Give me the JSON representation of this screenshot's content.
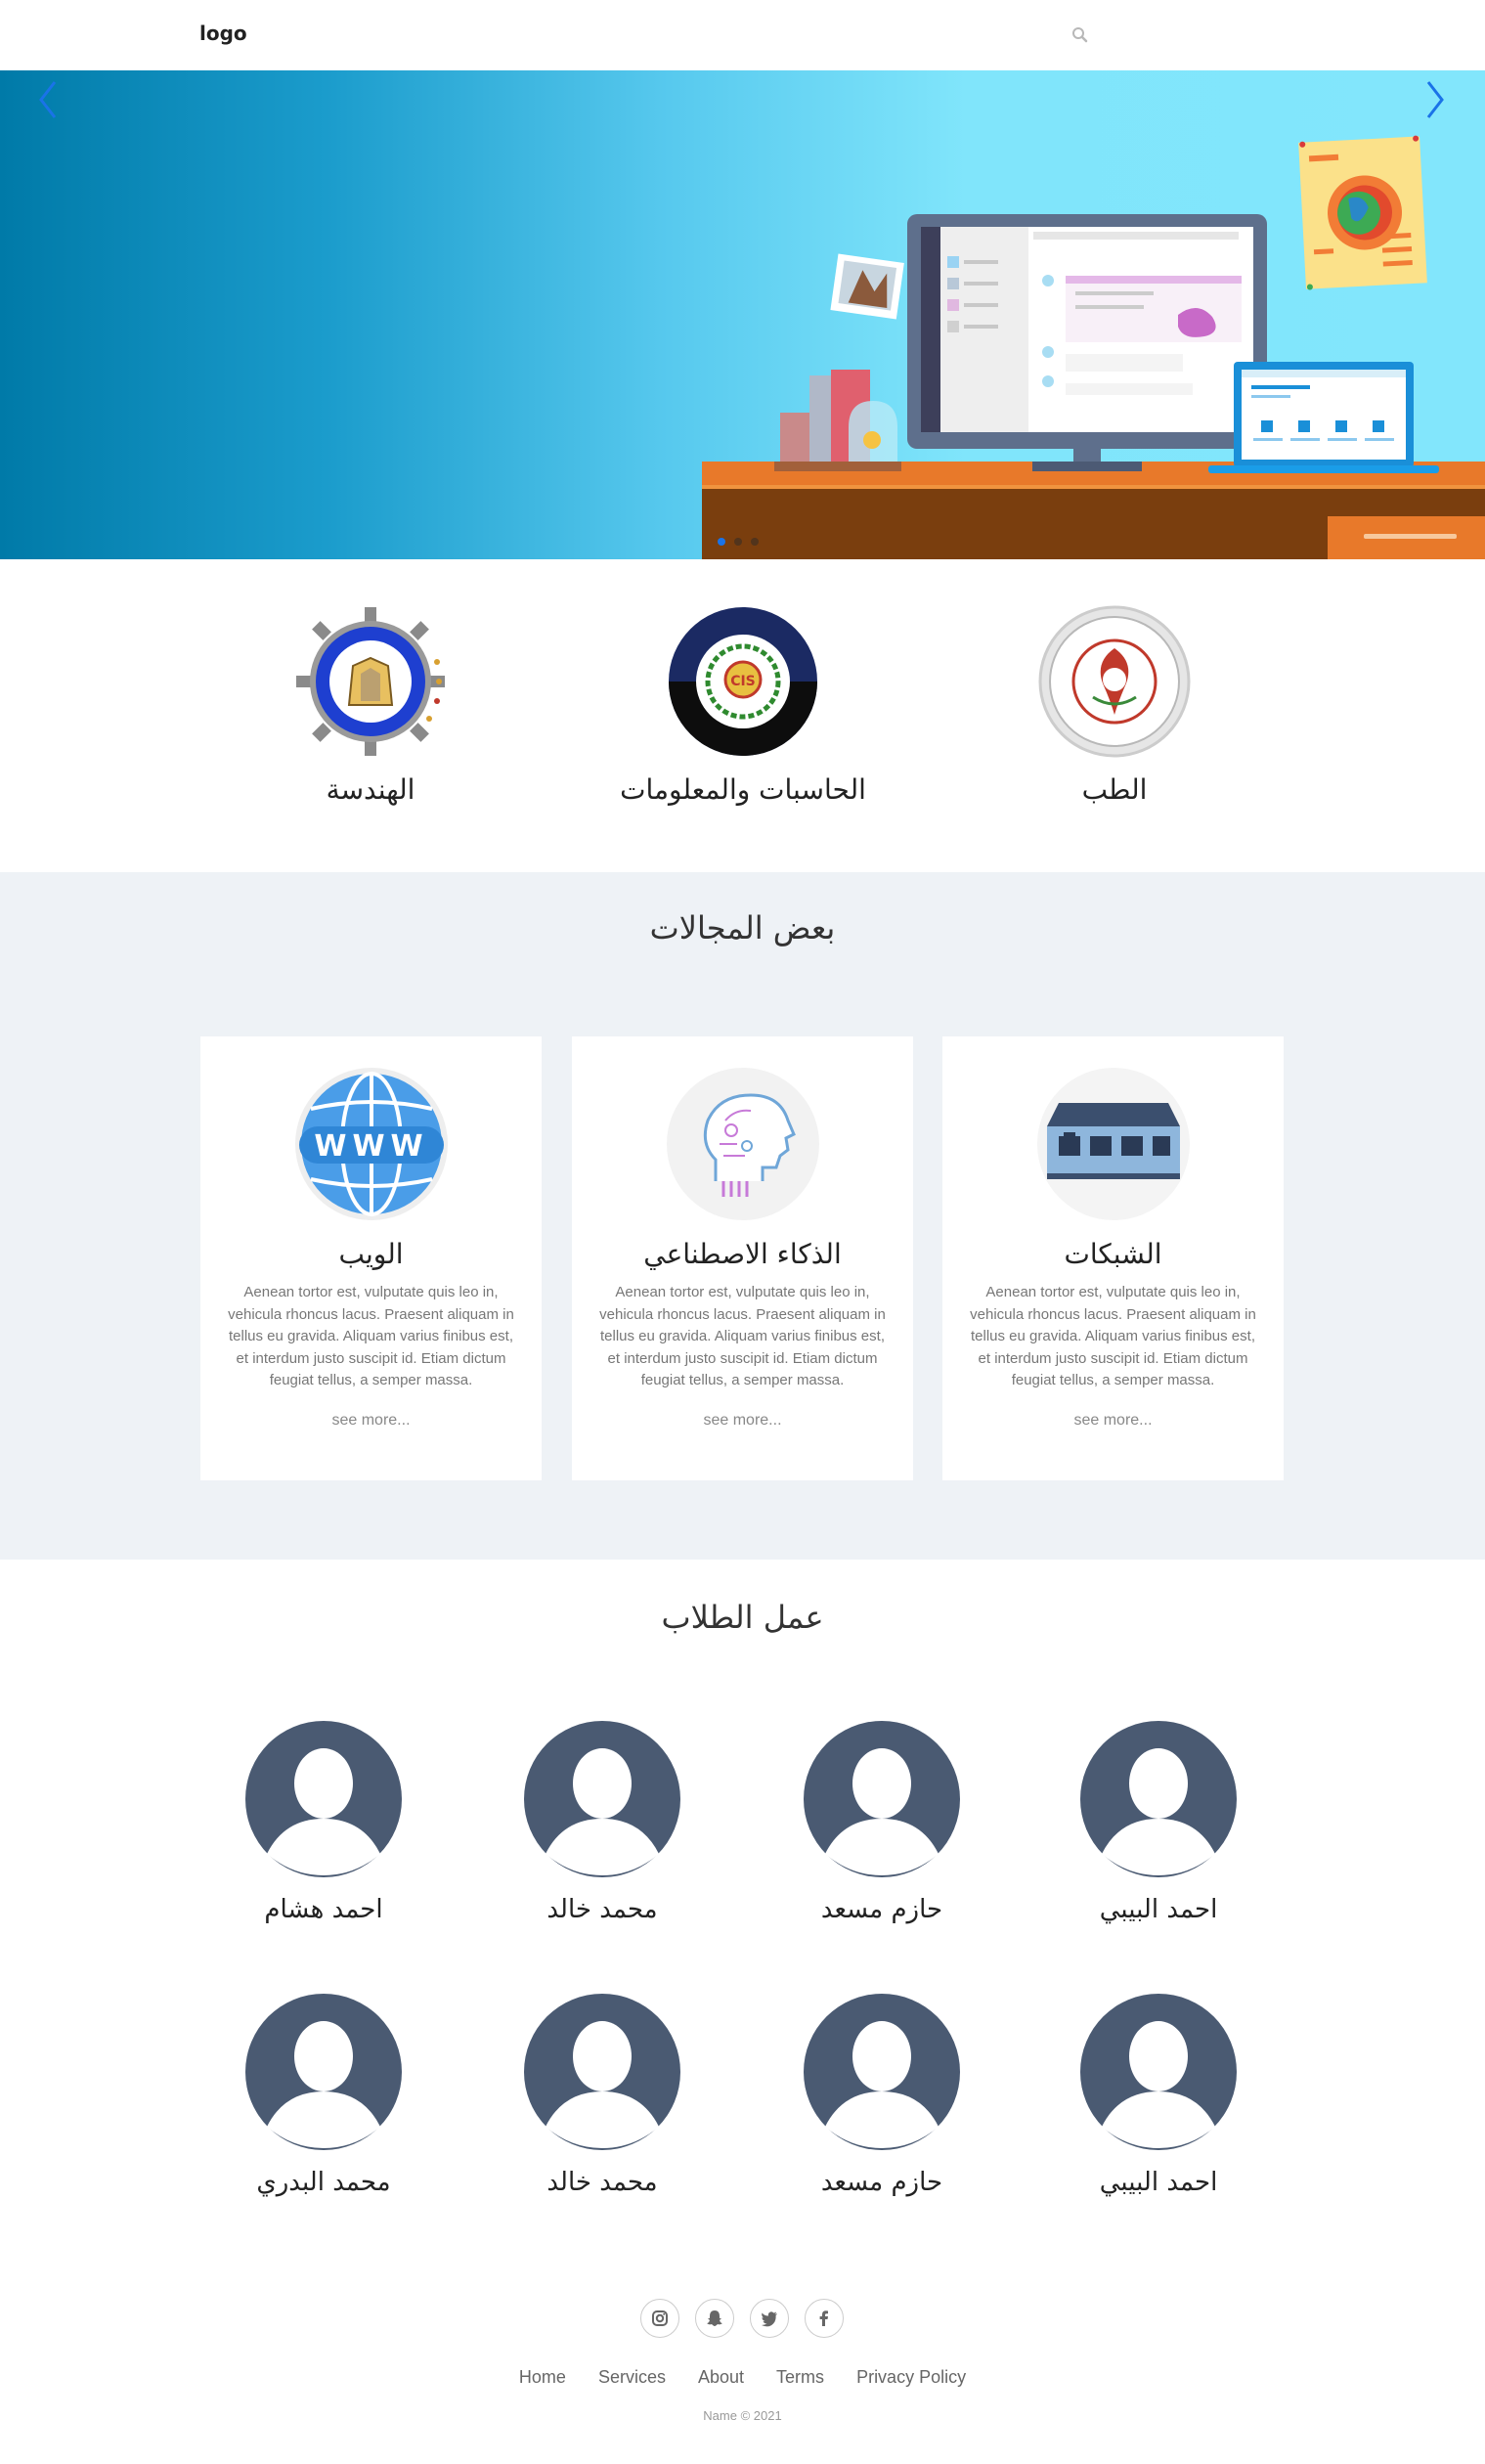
{
  "header": {
    "logo": "logo",
    "search_icon": "search-icon"
  },
  "hero": {
    "prev_icon": "chevron-left-icon",
    "next_icon": "chevron-right-icon",
    "slides": 3,
    "active_slide": 1
  },
  "faculties": [
    {
      "name": "الطب",
      "icon": "medicine-emblem"
    },
    {
      "name": "الحاسبات والمعلومات",
      "icon": "computers-information-emblem"
    },
    {
      "name": "الهندسة",
      "icon": "engineering-emblem"
    }
  ],
  "fields": {
    "title": "بعض المجالات",
    "cards": [
      {
        "title": "الشبكات",
        "icon": "network-switch-icon",
        "desc": "Aenean tortor est, vulputate quis leo in, vehicula rhoncus lacus. Praesent aliquam in tellus eu gravida. Aliquam varius finibus est, et interdum justo suscipit id. Etiam dictum feugiat tellus, a semper massa.",
        "more": "see more..."
      },
      {
        "title": "الذكاء الاصطناعي",
        "icon": "ai-head-icon",
        "desc": "Aenean tortor est, vulputate quis leo in, vehicula rhoncus lacus. Praesent aliquam in tellus eu gravida. Aliquam varius finibus est, et interdum justo suscipit id. Etiam dictum feugiat tellus, a semper massa.",
        "more": "see more..."
      },
      {
        "title": "الويب",
        "icon": "www-globe-icon",
        "desc": "Aenean tortor est, vulputate quis leo in, vehicula rhoncus lacus. Praesent aliquam in tellus eu gravida. Aliquam varius finibus est, et interdum justo suscipit id. Etiam dictum feugiat tellus, a semper massa.",
        "more": "see more..."
      }
    ]
  },
  "students": {
    "title": "عمل الطلاب",
    "people": [
      "احمد البيبي",
      "حازم مسعد",
      "محمد خالد",
      "احمد هشام",
      "احمد البيبي",
      "حازم مسعد",
      "محمد خالد",
      "محمد البدري"
    ]
  },
  "footer": {
    "socials": [
      "instagram-icon",
      "snapchat-icon",
      "twitter-icon",
      "facebook-icon"
    ],
    "links": [
      "Home",
      "Services",
      "About",
      "Terms",
      "Privacy Policy"
    ],
    "copyright": "Name © 2021"
  },
  "colors": {
    "avatar": "#4a5a72",
    "hero_dark": "#007aa8",
    "hero_light": "#82e6fc",
    "desk": "#e8792a",
    "active_dot": "#1a73e8"
  }
}
